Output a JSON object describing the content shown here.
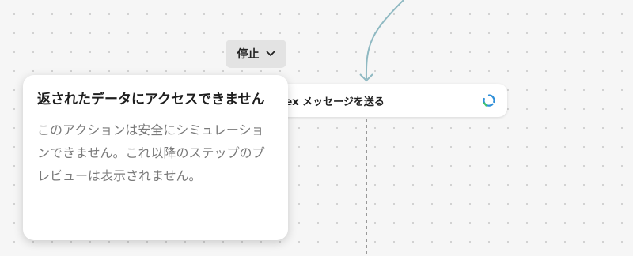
{
  "stop_button": {
    "label": "停止",
    "icon": "chevron-down-icon"
  },
  "step_card": {
    "label": "lex メッセージを送る",
    "icon": "refresh-cycle-icon"
  },
  "tooltip": {
    "title": "返されたデータにアクセスできません",
    "body": "このアクションは安全にシミュレーションできません。これ以降のステップのプレビューは表示されません。"
  },
  "colors": {
    "connector": "#8fb9c2",
    "icon_blue": "#2f8fd8",
    "icon_green": "#3ec46d",
    "background": "#f6f6f6"
  }
}
